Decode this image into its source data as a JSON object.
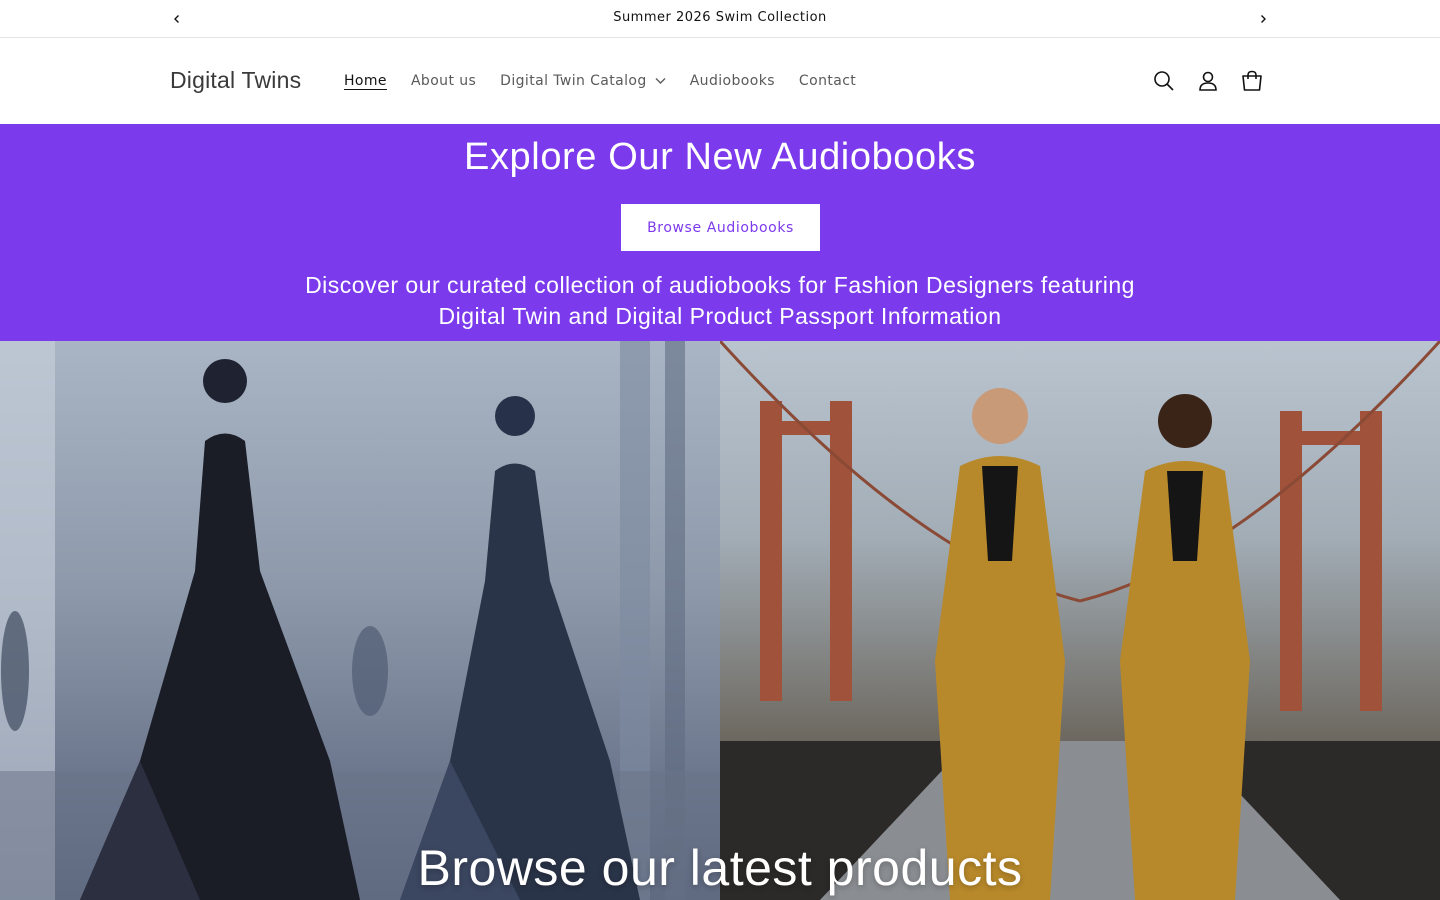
{
  "announcement": {
    "text": "Summer 2026 Swim Collection",
    "prev_icon": "chevron-left-icon",
    "next_icon": "chevron-right-icon"
  },
  "header": {
    "logo": "Digital Twins",
    "nav": [
      {
        "label": "Home",
        "active": true
      },
      {
        "label": "About us"
      },
      {
        "label": "Digital Twin Catalog",
        "has_dropdown": true
      },
      {
        "label": "Audiobooks"
      },
      {
        "label": "Contact"
      }
    ],
    "icons": [
      "search-icon",
      "account-icon",
      "cart-icon"
    ]
  },
  "banner": {
    "title": "Explore Our New Audiobooks",
    "button_label": "Browse Audiobooks",
    "description": "Discover our curated collection of audiobooks for Fashion Designers featuring Digital Twin and Digital Product Passport Information",
    "background_color": "#7c3aed",
    "button_text_color": "#7c3aed"
  },
  "hero": {
    "title": "Browse our latest products"
  }
}
